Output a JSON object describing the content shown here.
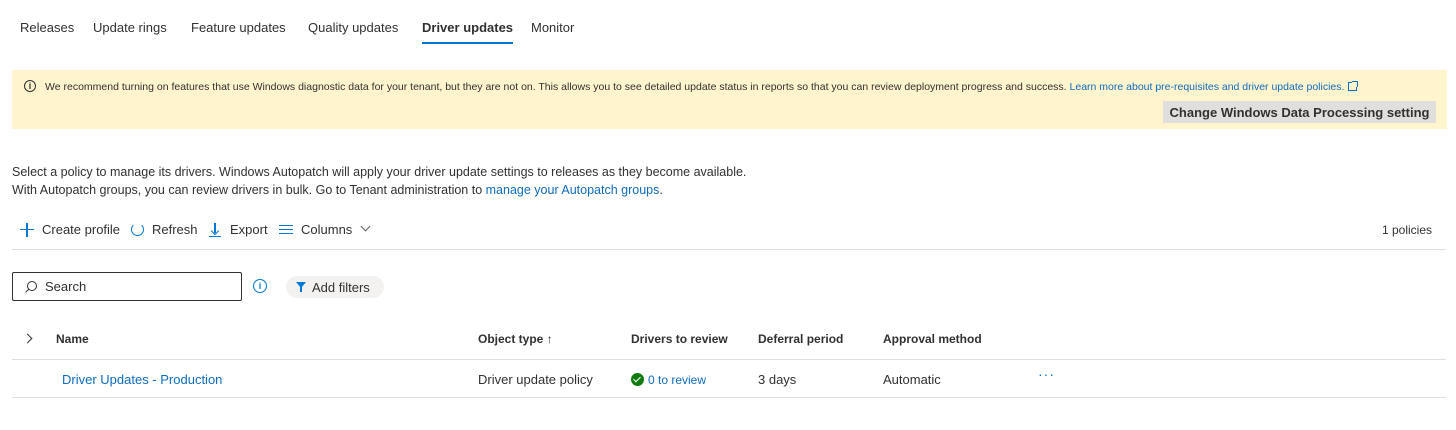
{
  "tabs": [
    {
      "label": "Releases"
    },
    {
      "label": "Update rings"
    },
    {
      "label": "Feature updates"
    },
    {
      "label": "Quality updates"
    },
    {
      "label": "Driver updates",
      "active": true
    },
    {
      "label": "Monitor"
    }
  ],
  "banner": {
    "message": "We recommend turning on features that use Windows diagnostic data for your tenant, but they are not on. This allows you to see detailed update status in reports so that you can review deployment progress and success.",
    "link": "Learn more about pre-requisites and driver update policies.",
    "button": "Change Windows Data Processing setting",
    "bg_color": "#fff4ce"
  },
  "description": {
    "line1": "Select a policy to manage its drivers. Windows Autopatch will apply your driver update settings to releases as they become available.",
    "line2_prefix": "With Autopatch groups, you can review drivers in bulk. Go to Tenant administration to",
    "line2_link": "manage your Autopatch groups",
    "line2_suffix": "."
  },
  "toolbar": {
    "create": "Create profile",
    "refresh": "Refresh",
    "export": "Export",
    "columns": "Columns",
    "count": "1 policies"
  },
  "search": {
    "placeholder": "Search"
  },
  "filters": {
    "label": "Add filters"
  },
  "table": {
    "headers": {
      "name": "Name",
      "object_type": "Object type ↑",
      "drivers": "Drivers to review",
      "deferral": "Deferral period",
      "approval": "Approval method"
    },
    "rows": [
      {
        "name": "Driver Updates - Production",
        "object_type": "Driver update policy",
        "drivers": "0 to review",
        "deferral": "3 days",
        "approval": "Automatic",
        "more": "···"
      }
    ]
  },
  "colors": {
    "accent": "#0078d4",
    "link": "#0f6cbd",
    "success": "#107c10"
  }
}
